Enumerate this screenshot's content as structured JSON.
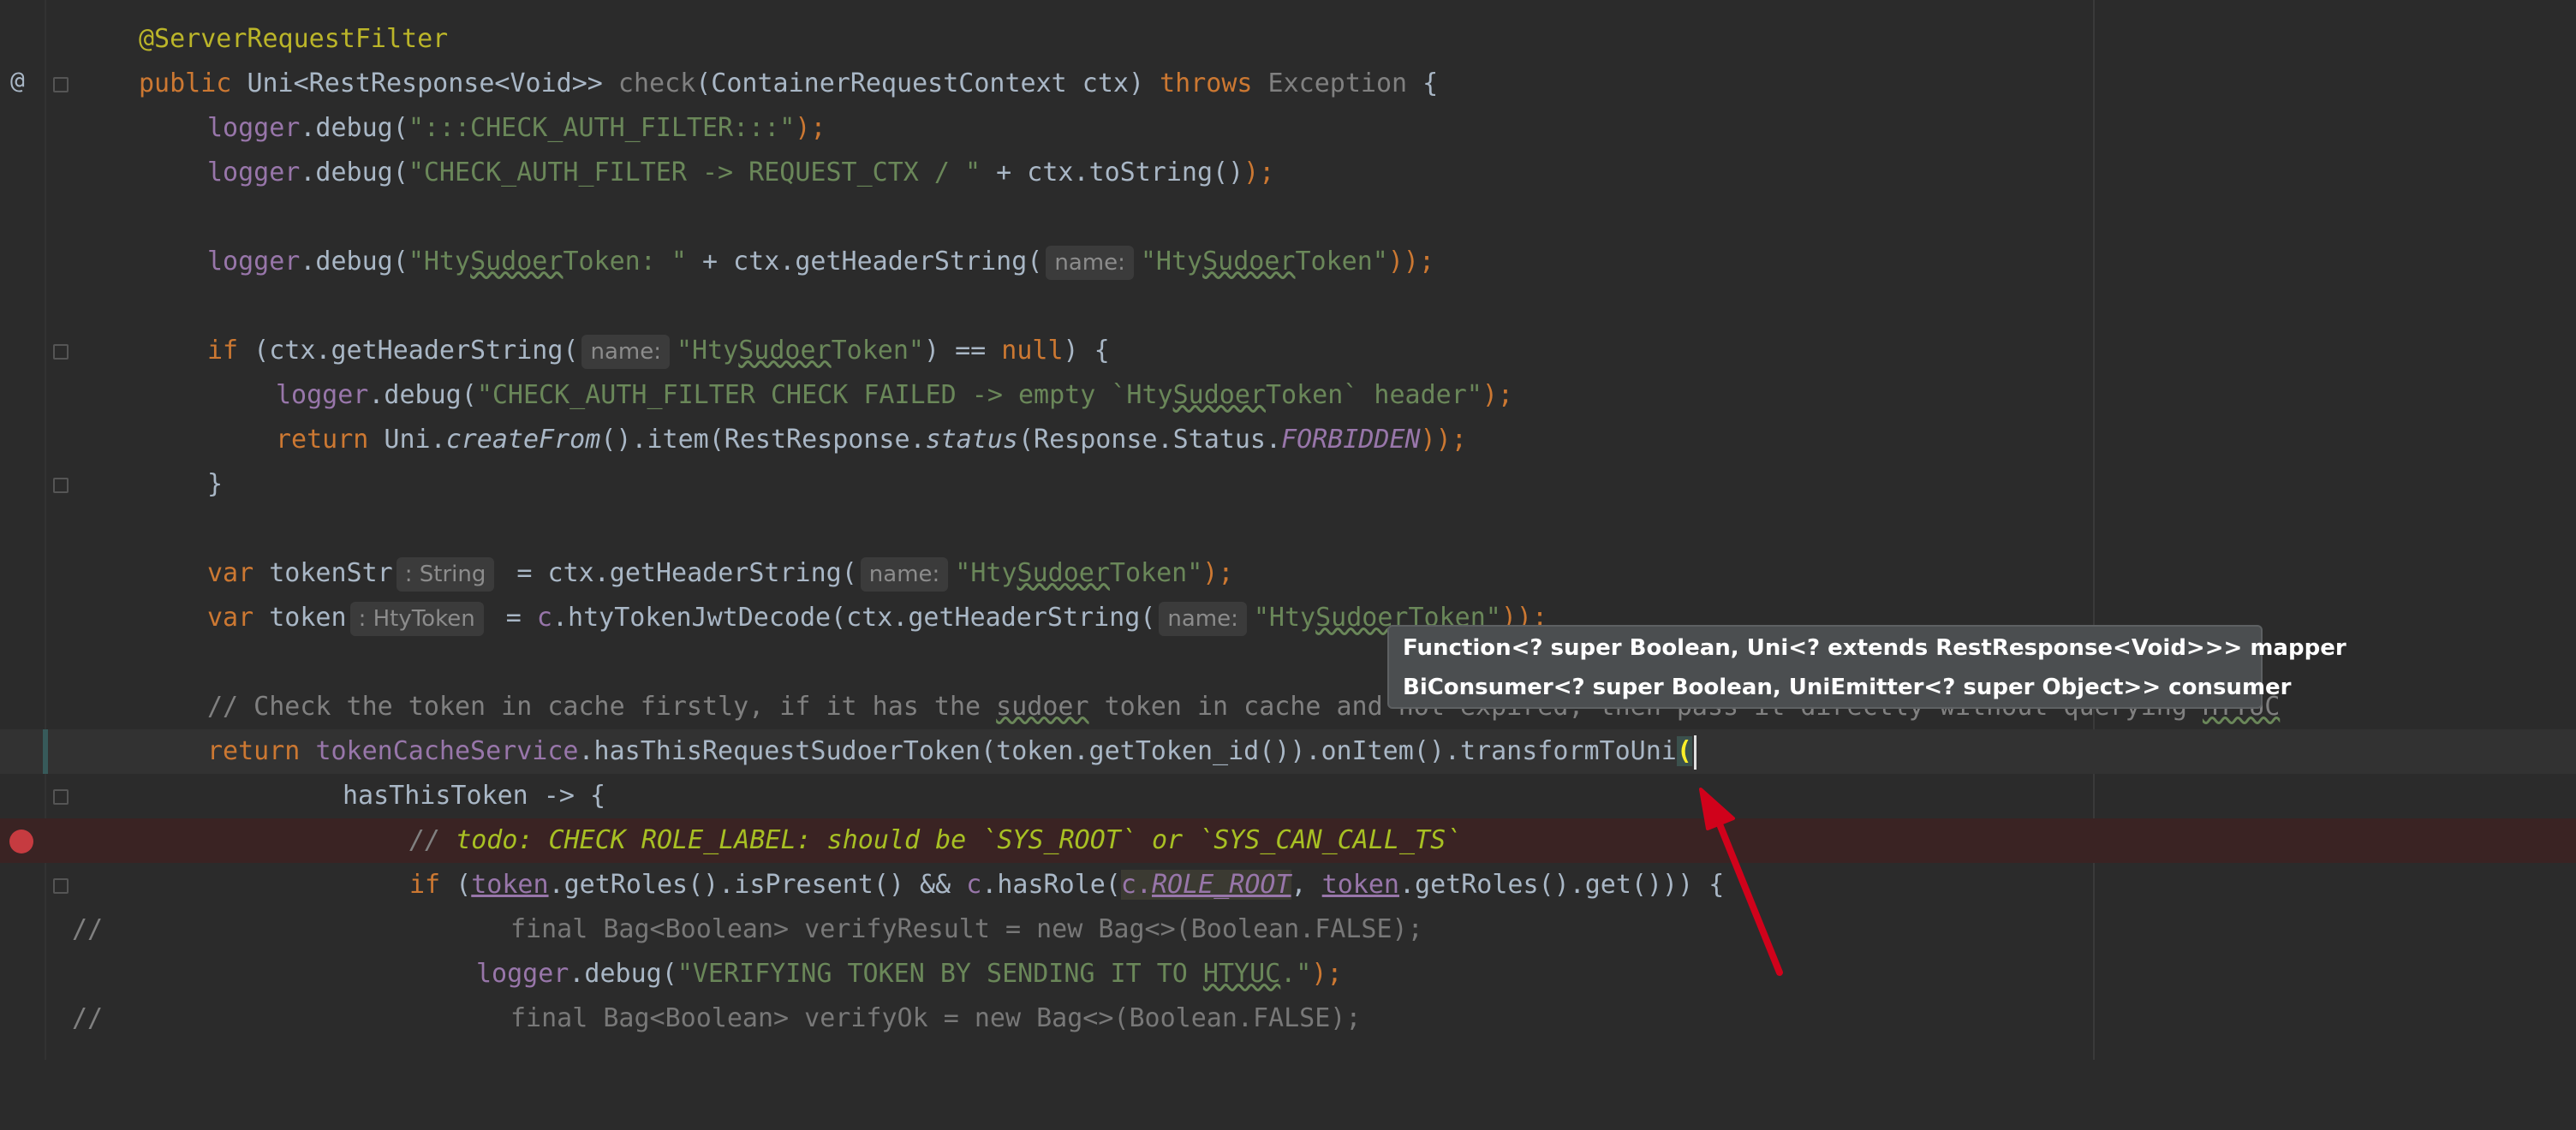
{
  "gutter": {
    "annotation_marker": "@"
  },
  "code": {
    "annotation": "@ServerRequestFilter",
    "l2": {
      "kw_public": "public",
      "type": "Uni<RestResponse<Void>>",
      "method": "check",
      "params": "(ContainerRequestContext ctx)",
      "kw_throws": "throws",
      "exception": "Exception",
      "brace": "{"
    },
    "l3": {
      "obj": "logger",
      "call": ".debug(",
      "str": "\":::CHECK_AUTH_FILTER:::\"",
      "end": ");"
    },
    "l4": {
      "obj": "logger",
      "call": ".debug(",
      "str": "\"CHECK_AUTH_FILTER -> REQUEST_CTX / \"",
      "rest": " + ctx.toString()",
      "end": ");"
    },
    "l6": {
      "obj": "logger",
      "call": ".debug(",
      "str1": "\"Hty",
      "str_u": "Sudoer",
      "str2": "Token: \"",
      "rest": " + ctx.getHeaderString(",
      "hint": "name:",
      "arg1": "\"Hty",
      "arg_u": "Sudoer",
      "arg2": "Token\"",
      "end": "));"
    },
    "l8": {
      "kw_if": "if",
      "p1": " (ctx.getHeaderString(",
      "hint": "name:",
      "s1": "\"Hty",
      "s_u": "Sudoer",
      "s2": "Token\"",
      "p2": ") == ",
      "kw_null": "null",
      "p3": ") {"
    },
    "l9": {
      "obj": "logger",
      "call": ".debug(",
      "s1": "\"CHECK_AUTH_FILTER CHECK FAILED -> empty `Hty",
      "s_u": "Sudoer",
      "s2": "Token` header\"",
      "end": ");"
    },
    "l10": {
      "kw_return": "return",
      "p1": " Uni.",
      "m1": "createFrom",
      "p2": "().item(RestResponse.",
      "m2": "status",
      "p3": "(Response.Status.",
      "const": "FORBIDDEN",
      "end": "));"
    },
    "l11": {
      "brace": "}"
    },
    "l13": {
      "kw_var": "var",
      "name": " tokenStr",
      "hint": ": String",
      "p1": " = ctx.getHeaderString(",
      "hint2": "name:",
      "s1": "\"Hty",
      "s_u": "Sudoer",
      "s2": "Token\"",
      "end": ");"
    },
    "l14": {
      "kw_var": "var",
      "name": " token",
      "hint": ": HtyToken",
      "p1": " = ",
      "c": "c",
      "p2": ".htyTokenJwtDecode(ctx.getHeaderString(",
      "hint2": "name:",
      "s1": "\"Hty",
      "s_u": "Sudoer",
      "s2": "Token\"",
      "end": "));"
    },
    "l16": {
      "c1": "// Check the token in cache firstly, if it has the ",
      "c_u": "sudoer",
      "c2": " token in cache and not expired, then pass it directly without querying ",
      "c_u2": "HTYUC"
    },
    "l17": {
      "kw_return": "return",
      "field": "tokenCacheService",
      "p1": ".hasThisRequestSudoerToken(token.getToken_id()).onItem().transformToUni",
      "bracket": "("
    },
    "l18": {
      "text": "hasThisToken -> {"
    },
    "l19": {
      "slashes": "// ",
      "todo": "todo: CHECK ROLE_LABEL: should be `SYS_ROOT` or `SYS_CAN_CALL_TS`"
    },
    "l20": {
      "kw_if": "if",
      "p1": " (",
      "tok": "token",
      "p2": ".getRoles().isPresent() && ",
      "c": "c",
      "p3": ".hasRole(",
      "c2": "c.",
      "const": "ROLE_ROOT",
      "p4": ", ",
      "tok2": "token",
      "p5": ".getRoles().get())) {"
    },
    "l21": {
      "slashes": "//",
      "text": "final Bag<Boolean> verifyResult = new Bag<>(Boolean.FALSE);"
    },
    "l22": {
      "obj": "logger",
      "call": ".debug(",
      "s1": "\"VERIFYING TOKEN BY SENDING IT TO ",
      "s_u": "HTYUC",
      "s2": ".\"",
      "end": ");"
    },
    "l23": {
      "slashes": "//",
      "text": "final Bag<Boolean> verifyOk = new Bag<>(Boolean.FALSE);"
    }
  },
  "tooltip": {
    "items": [
      "Function<? super Boolean, Uni<? extends RestResponse<Void>>> mapper",
      "BiConsumer<? super Boolean, UniEmitter<? super Object>> consumer"
    ]
  },
  "colors": {
    "background": "#2b2b2b",
    "keyword": "#cc7832",
    "string": "#6a8759",
    "annotation": "#bbb529",
    "field": "#9876aa",
    "breakpoint": "#c63b40",
    "arrow": "#d0021b"
  }
}
